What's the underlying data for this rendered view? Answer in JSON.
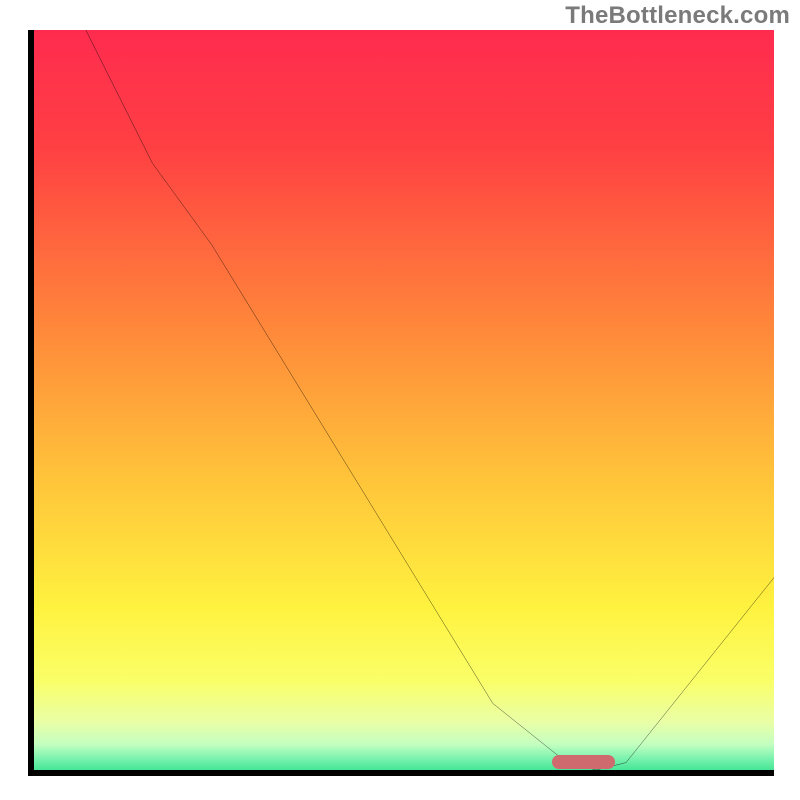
{
  "watermark": "TheBottleneck.com",
  "chart_data": {
    "type": "line",
    "title": "",
    "xlabel": "",
    "ylabel": "",
    "xlim": [
      0,
      100
    ],
    "ylim": [
      0,
      100
    ],
    "grid": false,
    "legend": false,
    "x": [
      7,
      16,
      24,
      62,
      72,
      76,
      80,
      100
    ],
    "values": [
      100,
      82,
      71,
      9,
      1,
      0,
      1,
      26
    ],
    "marker": {
      "x_start": 70,
      "x_end": 78.5,
      "y": 0.2
    },
    "background_gradient_stops": [
      {
        "offset": 0.0,
        "color": "#ff2b4f"
      },
      {
        "offset": 0.16,
        "color": "#ff4043"
      },
      {
        "offset": 0.4,
        "color": "#ff873a"
      },
      {
        "offset": 0.6,
        "color": "#ffc23a"
      },
      {
        "offset": 0.78,
        "color": "#fff23f"
      },
      {
        "offset": 0.88,
        "color": "#faff68"
      },
      {
        "offset": 0.935,
        "color": "#e9ffa6"
      },
      {
        "offset": 0.965,
        "color": "#c4ffc0"
      },
      {
        "offset": 0.985,
        "color": "#79f2ae"
      },
      {
        "offset": 1.0,
        "color": "#45e596"
      }
    ]
  }
}
